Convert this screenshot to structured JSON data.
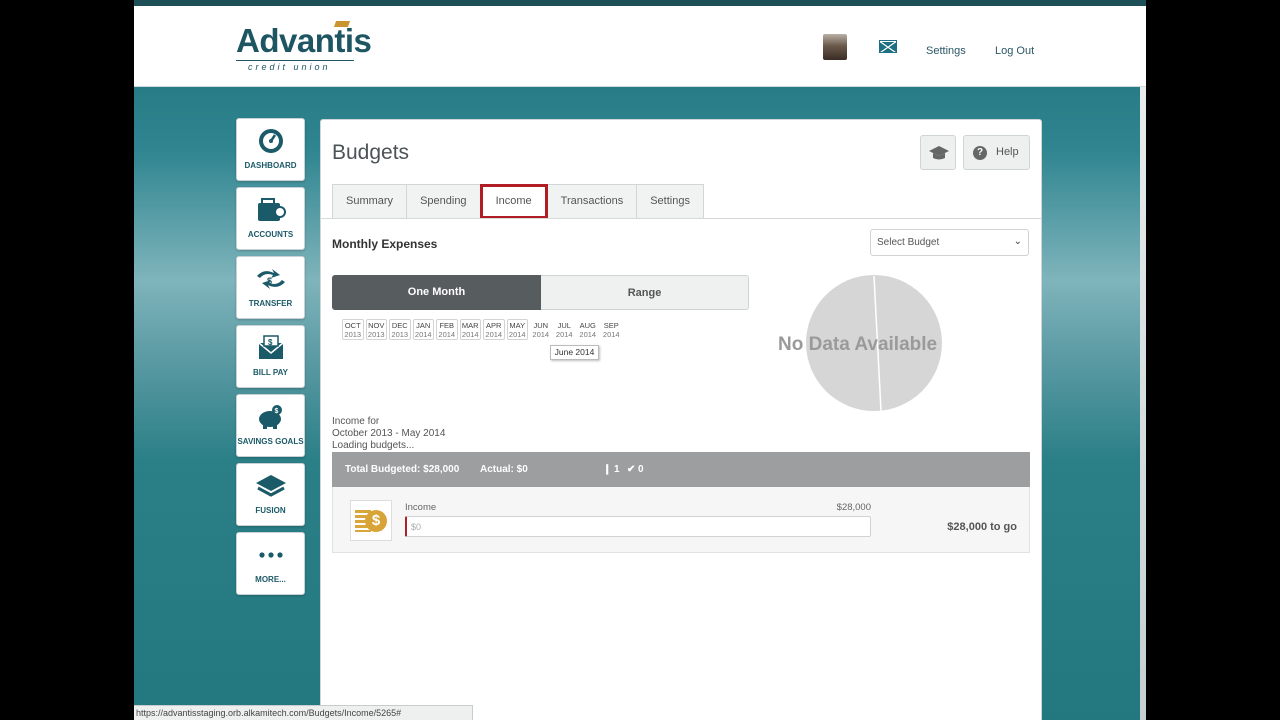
{
  "header": {
    "logo_main": "Advantis",
    "logo_sub": "credit union",
    "settings_label": "Settings",
    "logout_label": "Log Out"
  },
  "sidebar": {
    "items": [
      {
        "label": "DASHBOARD",
        "icon": "dashboard-gauge-icon"
      },
      {
        "label": "ACCOUNTS",
        "icon": "wallet-icon"
      },
      {
        "label": "TRANSFER",
        "icon": "transfer-arrows-icon"
      },
      {
        "label": "BILL PAY",
        "icon": "envelope-icon"
      },
      {
        "label": "SAVINGS GOALS",
        "icon": "piggy-bank-icon"
      },
      {
        "label": "FUSION",
        "icon": "layers-icon"
      },
      {
        "label": "MORE...",
        "icon": "ellipsis-icon"
      }
    ]
  },
  "page": {
    "title": "Budgets",
    "help_label": "Help",
    "tabs": [
      "Summary",
      "Spending",
      "Income",
      "Transactions",
      "Settings"
    ],
    "active_tab": "Income",
    "section_title": "Monthly Expenses",
    "select_placeholder": "Select Budget",
    "range_options": [
      "One Month",
      "Range"
    ],
    "months": [
      {
        "m": "OCT",
        "y": "2013"
      },
      {
        "m": "NOV",
        "y": "2013"
      },
      {
        "m": "DEC",
        "y": "2013"
      },
      {
        "m": "JAN",
        "y": "2014"
      },
      {
        "m": "FEB",
        "y": "2014"
      },
      {
        "m": "MAR",
        "y": "2014"
      },
      {
        "m": "APR",
        "y": "2014"
      },
      {
        "m": "MAY",
        "y": "2014"
      },
      {
        "m": "JUN",
        "y": "2014"
      },
      {
        "m": "JUL",
        "y": "2014"
      },
      {
        "m": "AUG",
        "y": "2014"
      },
      {
        "m": "SEP",
        "y": "2014"
      }
    ],
    "tooltip": "June 2014",
    "no_data": "No Data Available",
    "income_for_1": "Income for",
    "income_for_2": "October 2013 - May 2014",
    "income_for_3": "Loading budgets...",
    "total_budgeted": "Total Budgeted: $28,000",
    "actual": "Actual: $0",
    "alert_count": "1",
    "check_count": "0",
    "row": {
      "label": "Income",
      "amount": "$28,000",
      "current": "$0",
      "togo": "$28,000 to go",
      "progress": 0
    }
  },
  "status_url": "https://advantisstaging.orb.alkamitech.com/Budgets/Income/5265#",
  "colors": {
    "brand": "#1d5563",
    "accent_red": "#b01d24",
    "gold": "#d8a437"
  }
}
